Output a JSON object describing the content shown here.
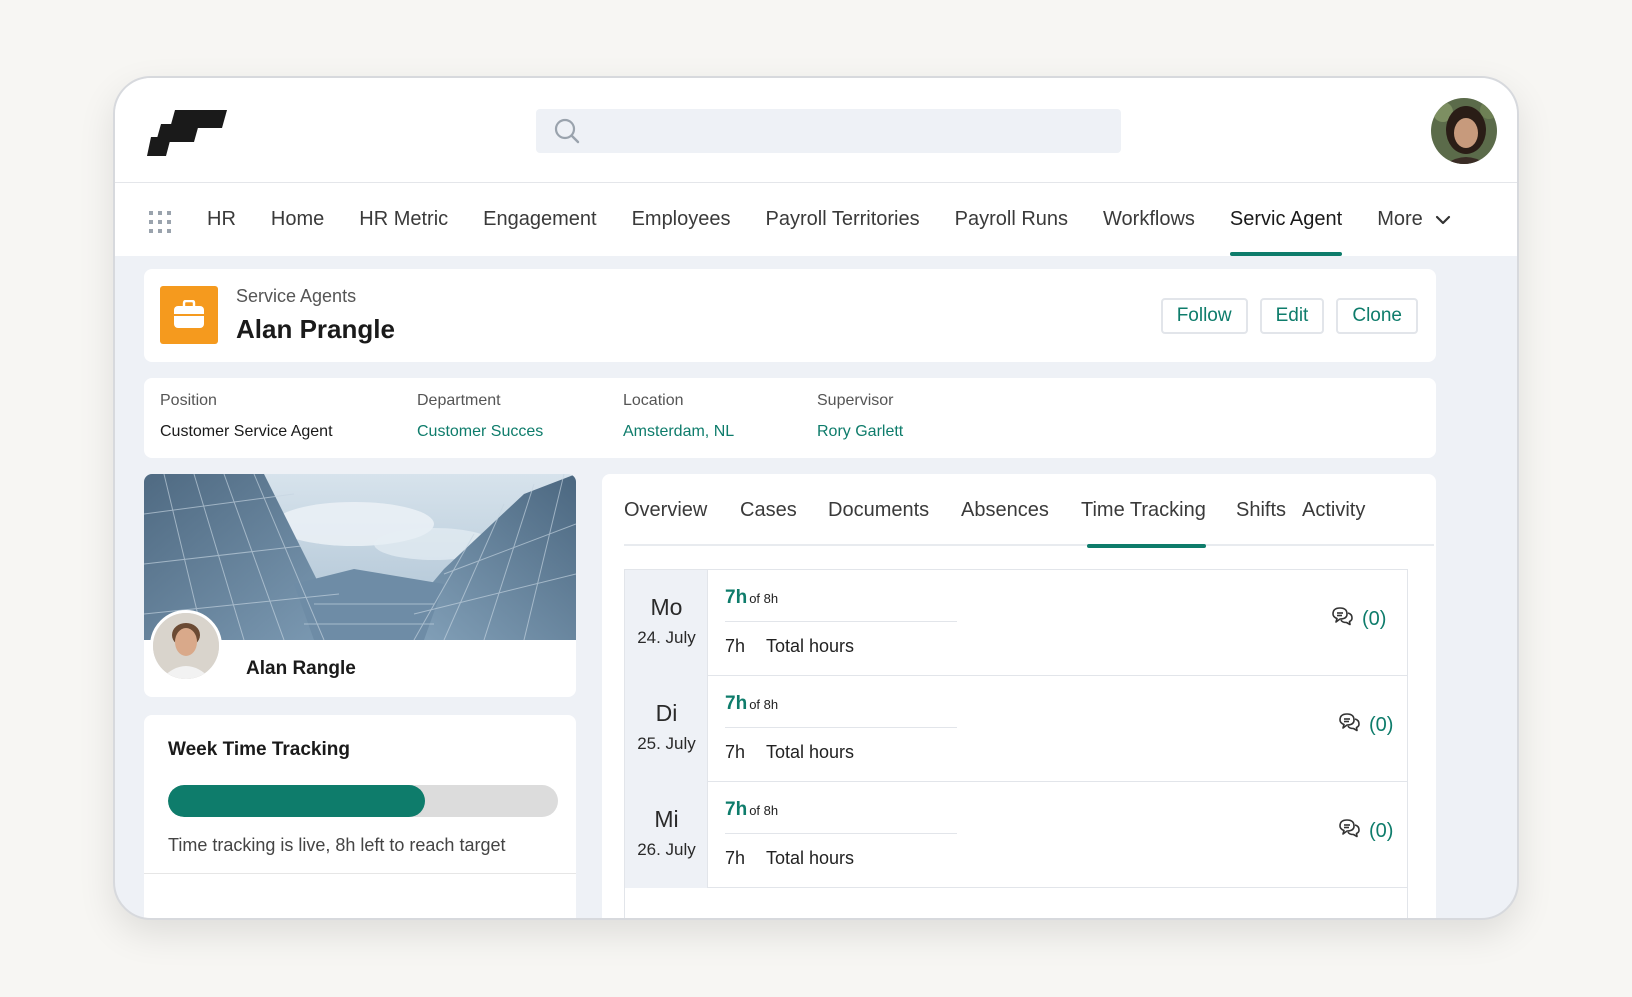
{
  "app": {
    "search": {
      "placeholder": ""
    },
    "nav": {
      "items": [
        {
          "label": "HR"
        },
        {
          "label": "Home"
        },
        {
          "label": "HR Metric"
        },
        {
          "label": "Engagement"
        },
        {
          "label": "Employees"
        },
        {
          "label": "Payroll Territories"
        },
        {
          "label": "Payroll Runs"
        },
        {
          "label": "Workflows"
        },
        {
          "label": "Servic Agent"
        }
      ],
      "more_label": "More"
    }
  },
  "record": {
    "type": "Service Agents",
    "name": "Alan Prangle",
    "icon": "briefcase-icon",
    "icon_color": "#f59a1e",
    "actions": {
      "follow": "Follow",
      "edit": "Edit",
      "clone": "Clone"
    }
  },
  "details": {
    "position": {
      "label": "Position",
      "value": "Customer Service Agent"
    },
    "department": {
      "label": "Department",
      "value": "Customer Succes"
    },
    "location": {
      "label": "Location",
      "value": "Amsterdam, NL"
    },
    "supervisor": {
      "label": "Supervisor",
      "value": "Rory Garlett"
    }
  },
  "profile": {
    "name": "Alan Rangle"
  },
  "week_tracking": {
    "title": "Week Time Tracking",
    "progress_percent": 66,
    "status": "Time tracking is live, 8h left to reach target"
  },
  "tabs": [
    {
      "label": "Overview"
    },
    {
      "label": "Cases"
    },
    {
      "label": "Documents"
    },
    {
      "label": "Absences"
    },
    {
      "label": "Time Tracking"
    },
    {
      "label": "Shifts"
    },
    {
      "label": "Activity"
    }
  ],
  "days": [
    {
      "abbr": "Mo",
      "date": "24. July",
      "hours": "7h",
      "of": "of 8h",
      "total_value": "7h",
      "total_label": "Total hours",
      "comments": "(0)"
    },
    {
      "abbr": "Di",
      "date": "25. July",
      "hours": "7h",
      "of": "of 8h",
      "total_value": "7h",
      "total_label": "Total hours",
      "comments": "(0)"
    },
    {
      "abbr": "Mi",
      "date": "26. July",
      "hours": "7h",
      "of": "of 8h",
      "total_value": "7h",
      "total_label": "Total hours",
      "comments": "(0)"
    }
  ],
  "colors": {
    "accent": "#0e7c6b",
    "record_icon": "#f59a1e",
    "background": "#eef1f6"
  }
}
